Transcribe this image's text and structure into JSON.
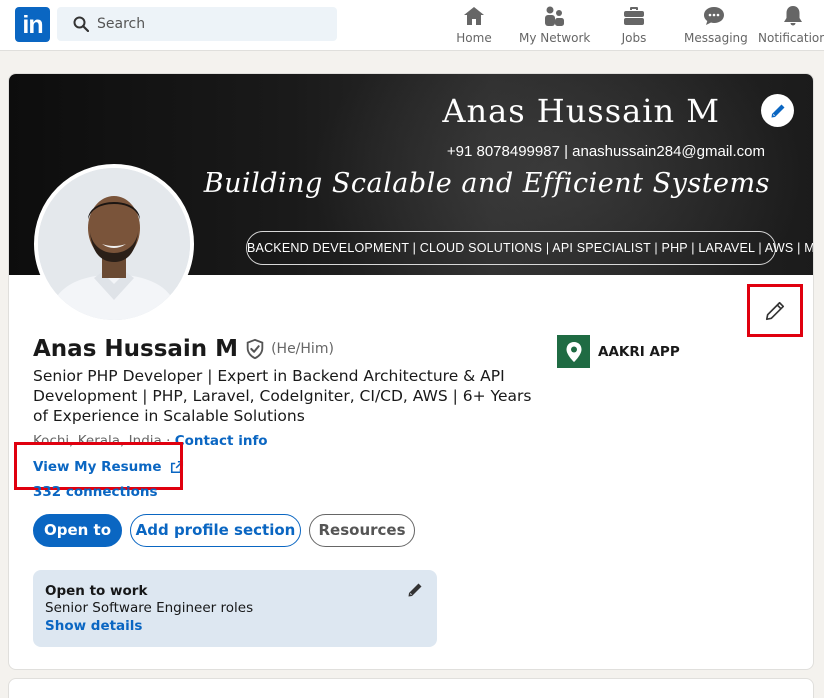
{
  "nav": {
    "logo": "in",
    "search_placeholder": "Search",
    "items": [
      {
        "label": "Home",
        "icon": "home-icon"
      },
      {
        "label": "My Network",
        "icon": "my-network-icon"
      },
      {
        "label": "Jobs",
        "icon": "briefcase-icon"
      },
      {
        "label": "Messaging",
        "icon": "messaging-icon"
      },
      {
        "label": "Notifications",
        "icon": "bell-icon"
      }
    ]
  },
  "banner": {
    "name": "Anas Hussain M",
    "contact": "+91 8078499987 | anashussain284@gmail.com",
    "tagline": "Building Scalable and Efficient Systems",
    "skills": "BACKEND DEVELOPMENT | CLOUD SOLUTIONS | API SPECIALIST | PHP | LARAVEL | AWS | MYSQL"
  },
  "profile": {
    "name": "Anas Hussain M",
    "pronouns": "(He/Him)",
    "headline": "Senior PHP Developer | Expert in Backend Architecture & API Development | PHP, Laravel, CodeIgniter, CI/CD, AWS | 6+ Years of Experience in Scalable Solutions",
    "location": "Kochi, Kerala, India",
    "separator": " · ",
    "contact_info": "Contact info",
    "resume_link": "View My Resume",
    "connections": "332 connections"
  },
  "actions": {
    "open_to": "Open to",
    "add_section": "Add profile section",
    "resources": "Resources"
  },
  "open_to_work": {
    "title": "Open to work",
    "roles": "Senior Software Engineer roles",
    "details": "Show details"
  },
  "company": {
    "name": "AAKRI APP"
  },
  "colors": {
    "brand": "#0a66c2",
    "highlight": "#e0000f",
    "company_logo": "#1f6b43",
    "open_to_work_bg": "#dde7f1"
  }
}
